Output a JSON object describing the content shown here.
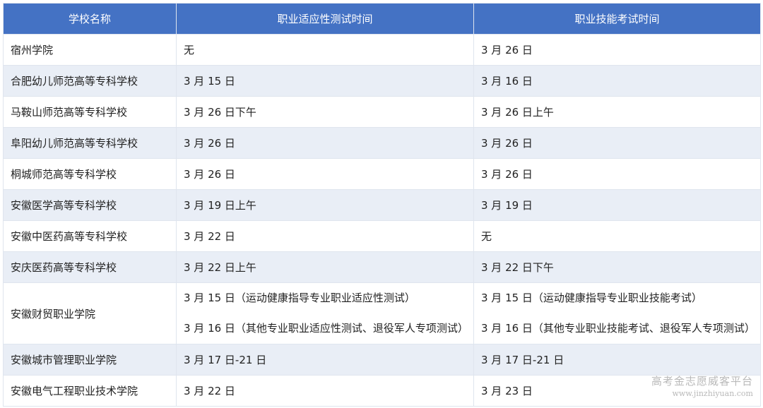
{
  "table": {
    "headers": [
      "学校名称",
      "职业适应性测试时间",
      "职业技能考试时间"
    ],
    "rows": [
      {
        "school": "宿州学院",
        "aptitude": [
          "无"
        ],
        "skills": [
          "3 月 26 日"
        ]
      },
      {
        "school": "合肥幼儿师范高等专科学校",
        "aptitude": [
          "3 月 15 日"
        ],
        "skills": [
          "3 月 16 日"
        ]
      },
      {
        "school": "马鞍山师范高等专科学校",
        "aptitude": [
          "3 月 26 日下午"
        ],
        "skills": [
          "3 月 26 日上午"
        ]
      },
      {
        "school": "阜阳幼儿师范高等专科学校",
        "aptitude": [
          "3 月 26 日"
        ],
        "skills": [
          "3 月 26 日"
        ]
      },
      {
        "school": "桐城师范高等专科学校",
        "aptitude": [
          "3 月 26 日"
        ],
        "skills": [
          "3 月 26 日"
        ]
      },
      {
        "school": "安徽医学高等专科学校",
        "aptitude": [
          "3 月 19 日上午"
        ],
        "skills": [
          "3 月 19 日"
        ]
      },
      {
        "school": "安徽中医药高等专科学校",
        "aptitude": [
          "3 月 22 日"
        ],
        "skills": [
          "无"
        ]
      },
      {
        "school": "安庆医药高等专科学校",
        "aptitude": [
          "3 月 22 日上午"
        ],
        "skills": [
          "3 月 22 日下午"
        ]
      },
      {
        "school": "安徽财贸职业学院",
        "aptitude": [
          "3 月 15 日（运动健康指导专业职业适应性测试）",
          "3 月 16 日（其他专业职业适应性测试、退役军人专项测试）"
        ],
        "skills": [
          "3 月 15 日（运动健康指导专业职业技能考试）",
          "3 月 16 日（其他专业职业技能考试、退役军人专项测试）"
        ]
      },
      {
        "school": "安徽城市管理职业学院",
        "aptitude": [
          "3 月 17 日-21 日"
        ],
        "skills": [
          "3 月 17 日-21 日"
        ]
      },
      {
        "school": "安徽电气工程职业技术学院",
        "aptitude": [
          "3 月 22 日"
        ],
        "skills": [
          "3 月 23 日"
        ]
      }
    ]
  },
  "watermark": {
    "name": "高考金志愿威客平台",
    "url": "www.jinzhiyuan.com"
  }
}
